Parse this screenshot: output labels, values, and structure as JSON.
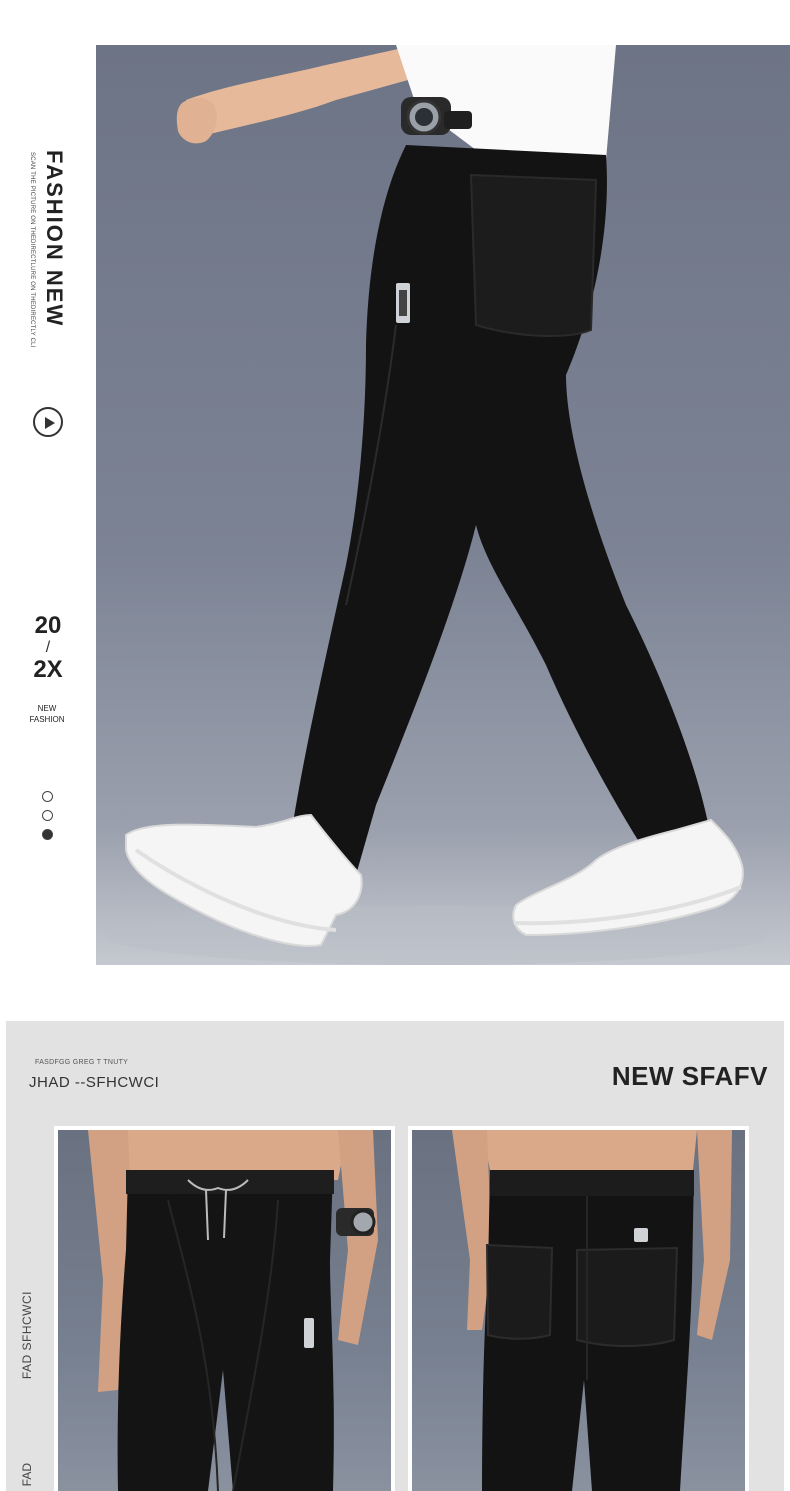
{
  "hero": {
    "title": "FASHION NEW",
    "subtitle": "SCAN THE PICTURE ON THEDIRECTLURE ON THEDIRECTLY CLI",
    "year_top": "20",
    "year_slash": "/",
    "year_bottom": "2X",
    "new_fashion_line1": "NEW",
    "new_fashion_line2": "FASHION",
    "carousel_dots": 3,
    "carousel_active_index": 2
  },
  "detail": {
    "sub_label": "FASDFGG GREG T TNUTY",
    "main_label": "JHAD --SFHCWCI",
    "headline": "NEW SFAFV",
    "side_label": "FAD SFHCWCI",
    "side_label_2": "FAD"
  },
  "colors": {
    "photo_background": "#6d7486",
    "pants": "#131313",
    "shoes": "#f5f5f5",
    "section_background": "#e2e2e2"
  }
}
